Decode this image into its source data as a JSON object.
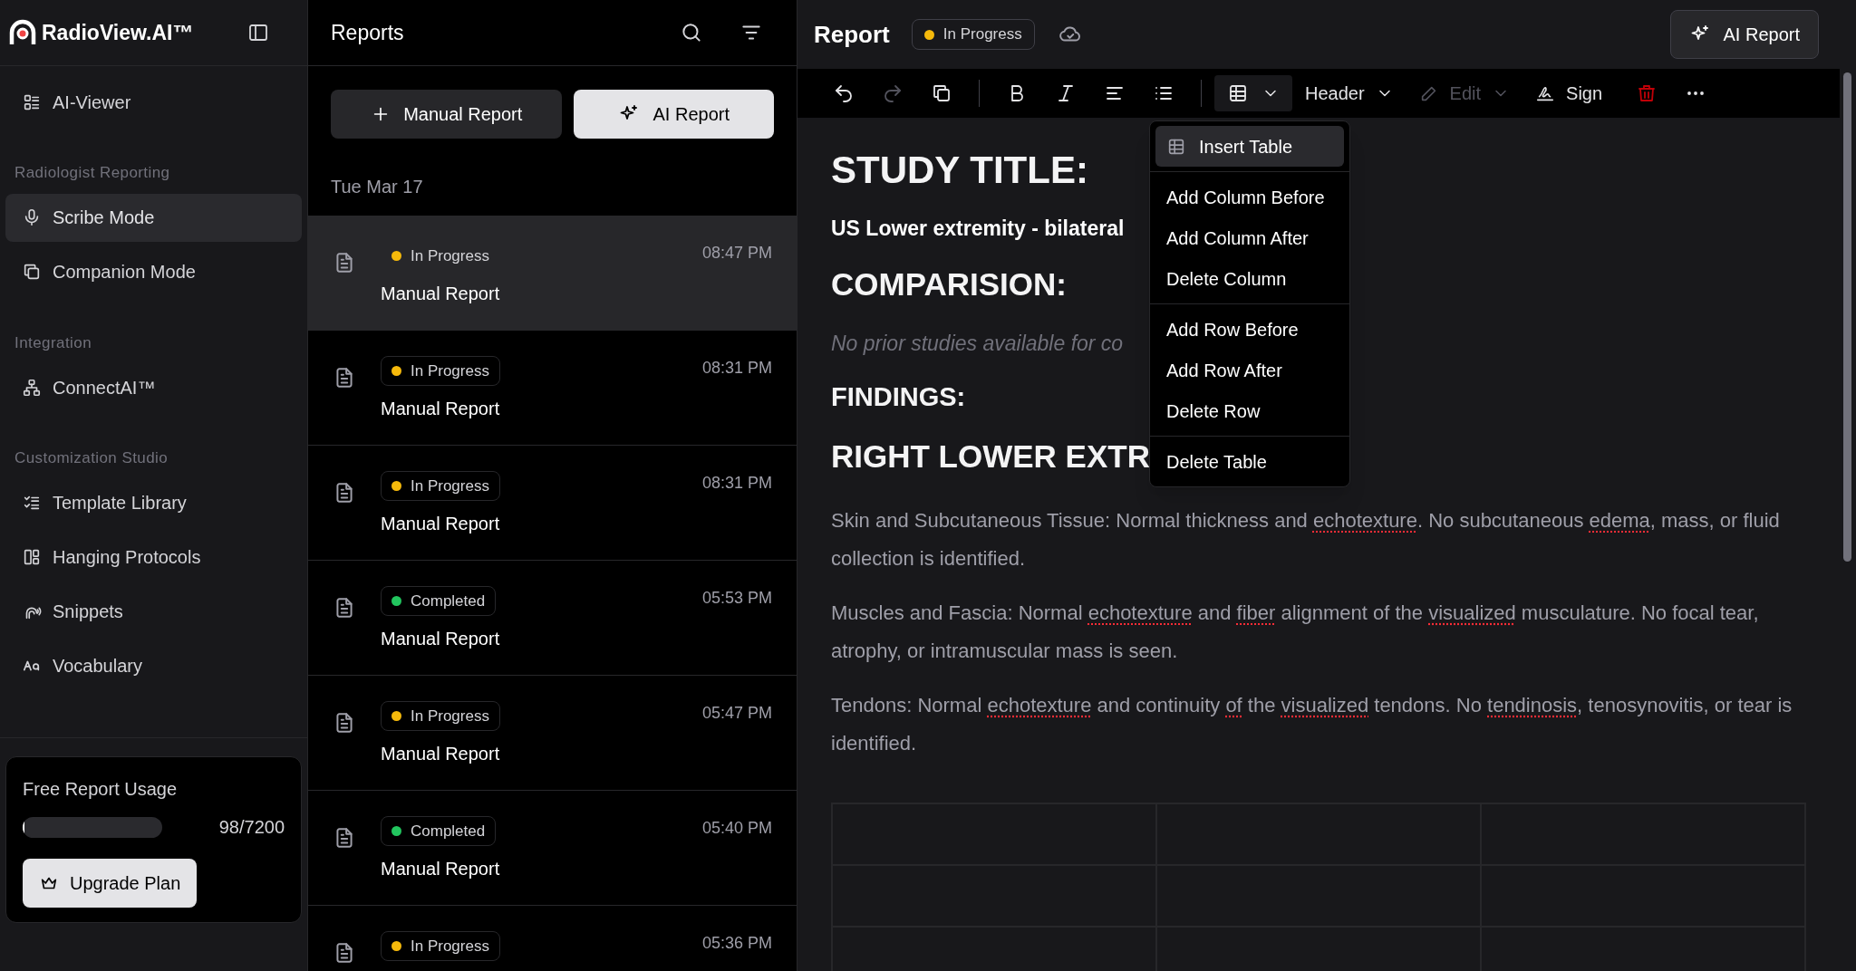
{
  "sidebar": {
    "brand": "RadioView.AI™",
    "sections": [
      {
        "items": [
          {
            "label": "AI-Viewer",
            "selected": false
          }
        ]
      },
      {
        "title": "Radiologist Reporting",
        "items": [
          {
            "label": "Scribe Mode",
            "selected": true
          },
          {
            "label": "Companion Mode",
            "selected": false
          }
        ]
      },
      {
        "title": "Integration",
        "items": [
          {
            "label": "ConnectAI™",
            "selected": false
          }
        ]
      },
      {
        "title": "Customization Studio",
        "items": [
          {
            "label": "Template Library",
            "selected": false
          },
          {
            "label": "Hanging Protocols",
            "selected": false
          },
          {
            "label": "Snippets",
            "selected": false
          },
          {
            "label": "Vocabulary",
            "selected": false
          }
        ]
      }
    ],
    "usage": {
      "title": "Free Report Usage",
      "level": 0.014,
      "reading": "98/7200",
      "button": "Upgrade Plan"
    }
  },
  "reports": {
    "title": "Reports",
    "buttons": [
      {
        "label": "Manual Report",
        "kind": "plus"
      },
      {
        "label": "AI Report",
        "kind": "sparkle"
      }
    ],
    "date": "Tue Mar 17",
    "items": [
      {
        "status": "In Progress",
        "color": "#f5b90b",
        "time": "08:47 PM",
        "title": "Manual Report",
        "selected": true
      },
      {
        "status": "In Progress",
        "color": "#f5b90b",
        "time": "08:31 PM",
        "title": "Manual Report",
        "selected": false
      },
      {
        "status": "In Progress",
        "color": "#f5b90b",
        "time": "08:31 PM",
        "title": "Manual Report",
        "selected": false
      },
      {
        "status": "Completed",
        "color": "#22c55e",
        "time": "05:53 PM",
        "title": "Manual Report",
        "selected": false
      },
      {
        "status": "In Progress",
        "color": "#f5b90b",
        "time": "05:47 PM",
        "title": "Manual Report",
        "selected": false
      },
      {
        "status": "Completed",
        "color": "#22c55e",
        "time": "05:40 PM",
        "title": "Manual Report",
        "selected": false
      },
      {
        "status": "In Progress",
        "color": "#f5b90b",
        "time": "05:36 PM",
        "selected": false
      }
    ]
  },
  "editor": {
    "title": "Report",
    "status": "In Progress",
    "ai_button": "AI Report",
    "toolbar": [
      {
        "kind": "undo"
      },
      {
        "kind": "redo",
        "disabled": true
      },
      {
        "kind": "duplicate"
      },
      {
        "kind": "divider"
      },
      {
        "kind": "bold"
      },
      {
        "kind": "italic"
      },
      {
        "kind": "align"
      },
      {
        "kind": "list"
      },
      {
        "kind": "divider"
      },
      {
        "kind": "table",
        "expanded": true
      },
      {
        "kind": "dropdown",
        "label": "Header"
      },
      {
        "kind": "edit",
        "label": "Edit",
        "disabled": true
      },
      {
        "kind": "sign",
        "label": "Sign"
      },
      {
        "kind": "delete"
      },
      {
        "kind": "more"
      }
    ],
    "menu": [
      [
        {
          "label": "Insert Table",
          "selected": true
        }
      ],
      [
        {
          "label": "Add Column Before",
          "selected": false
        },
        {
          "label": "Add Column After",
          "selected": false
        },
        {
          "label": "Delete Column",
          "selected": false
        }
      ],
      [
        {
          "label": "Add Row Before",
          "selected": false
        },
        {
          "label": "Add Row After",
          "selected": false
        },
        {
          "label": "Delete Row",
          "selected": false
        }
      ],
      [
        {
          "label": "Delete Table",
          "selected": false
        }
      ]
    ],
    "content": [
      {
        "kind": "h1",
        "text": "STUDY TITLE:"
      },
      {
        "kind": "strong",
        "text": "US Lower extremity - bilateral"
      },
      {
        "kind": "h2",
        "text": "COMPARISION:"
      },
      {
        "kind": "note",
        "text": "No prior studies available for co"
      },
      {
        "kind": "h3",
        "text": "FINDINGS:"
      },
      {
        "kind": "h2",
        "text": "RIGHT LOWER EXTR"
      },
      {
        "kind": "para",
        "segments": [
          {
            "text": "Skin and Subcutaneous Tissue: Normal thickness and ",
            "flagged": false
          },
          {
            "text": "echotexture",
            "flagged": true
          },
          {
            "text": ". No subcutaneous ",
            "flagged": false
          },
          {
            "text": "edema",
            "flagged": true
          },
          {
            "text": ", mass, or fluid collection is identified.",
            "flagged": false
          }
        ]
      },
      {
        "kind": "para",
        "segments": [
          {
            "text": "Muscles and Fascia: Normal ",
            "flagged": false
          },
          {
            "text": "echotexture",
            "flagged": true
          },
          {
            "text": " and ",
            "flagged": false
          },
          {
            "text": "fiber",
            "flagged": true
          },
          {
            "text": " alignment of the ",
            "flagged": false
          },
          {
            "text": "visualized",
            "flagged": true
          },
          {
            "text": " musculature. No focal tear, atrophy, or intramuscular mass is seen.",
            "flagged": false
          }
        ]
      },
      {
        "kind": "para",
        "segments": [
          {
            "text": "Tendons: Normal ",
            "flagged": false
          },
          {
            "text": "echotexture",
            "flagged": true
          },
          {
            "text": " and continuity ",
            "flagged": false
          },
          {
            "text": "of",
            "flagged": true
          },
          {
            "text": " the ",
            "flagged": false
          },
          {
            "text": "visualized",
            "flagged": true
          },
          {
            "text": " tendons. No ",
            "flagged": false
          },
          {
            "text": "tendinosis",
            "flagged": true
          },
          {
            "text": ", tenosynovitis, or tear is identified.",
            "flagged": false
          }
        ]
      },
      {
        "kind": "table"
      }
    ]
  }
}
